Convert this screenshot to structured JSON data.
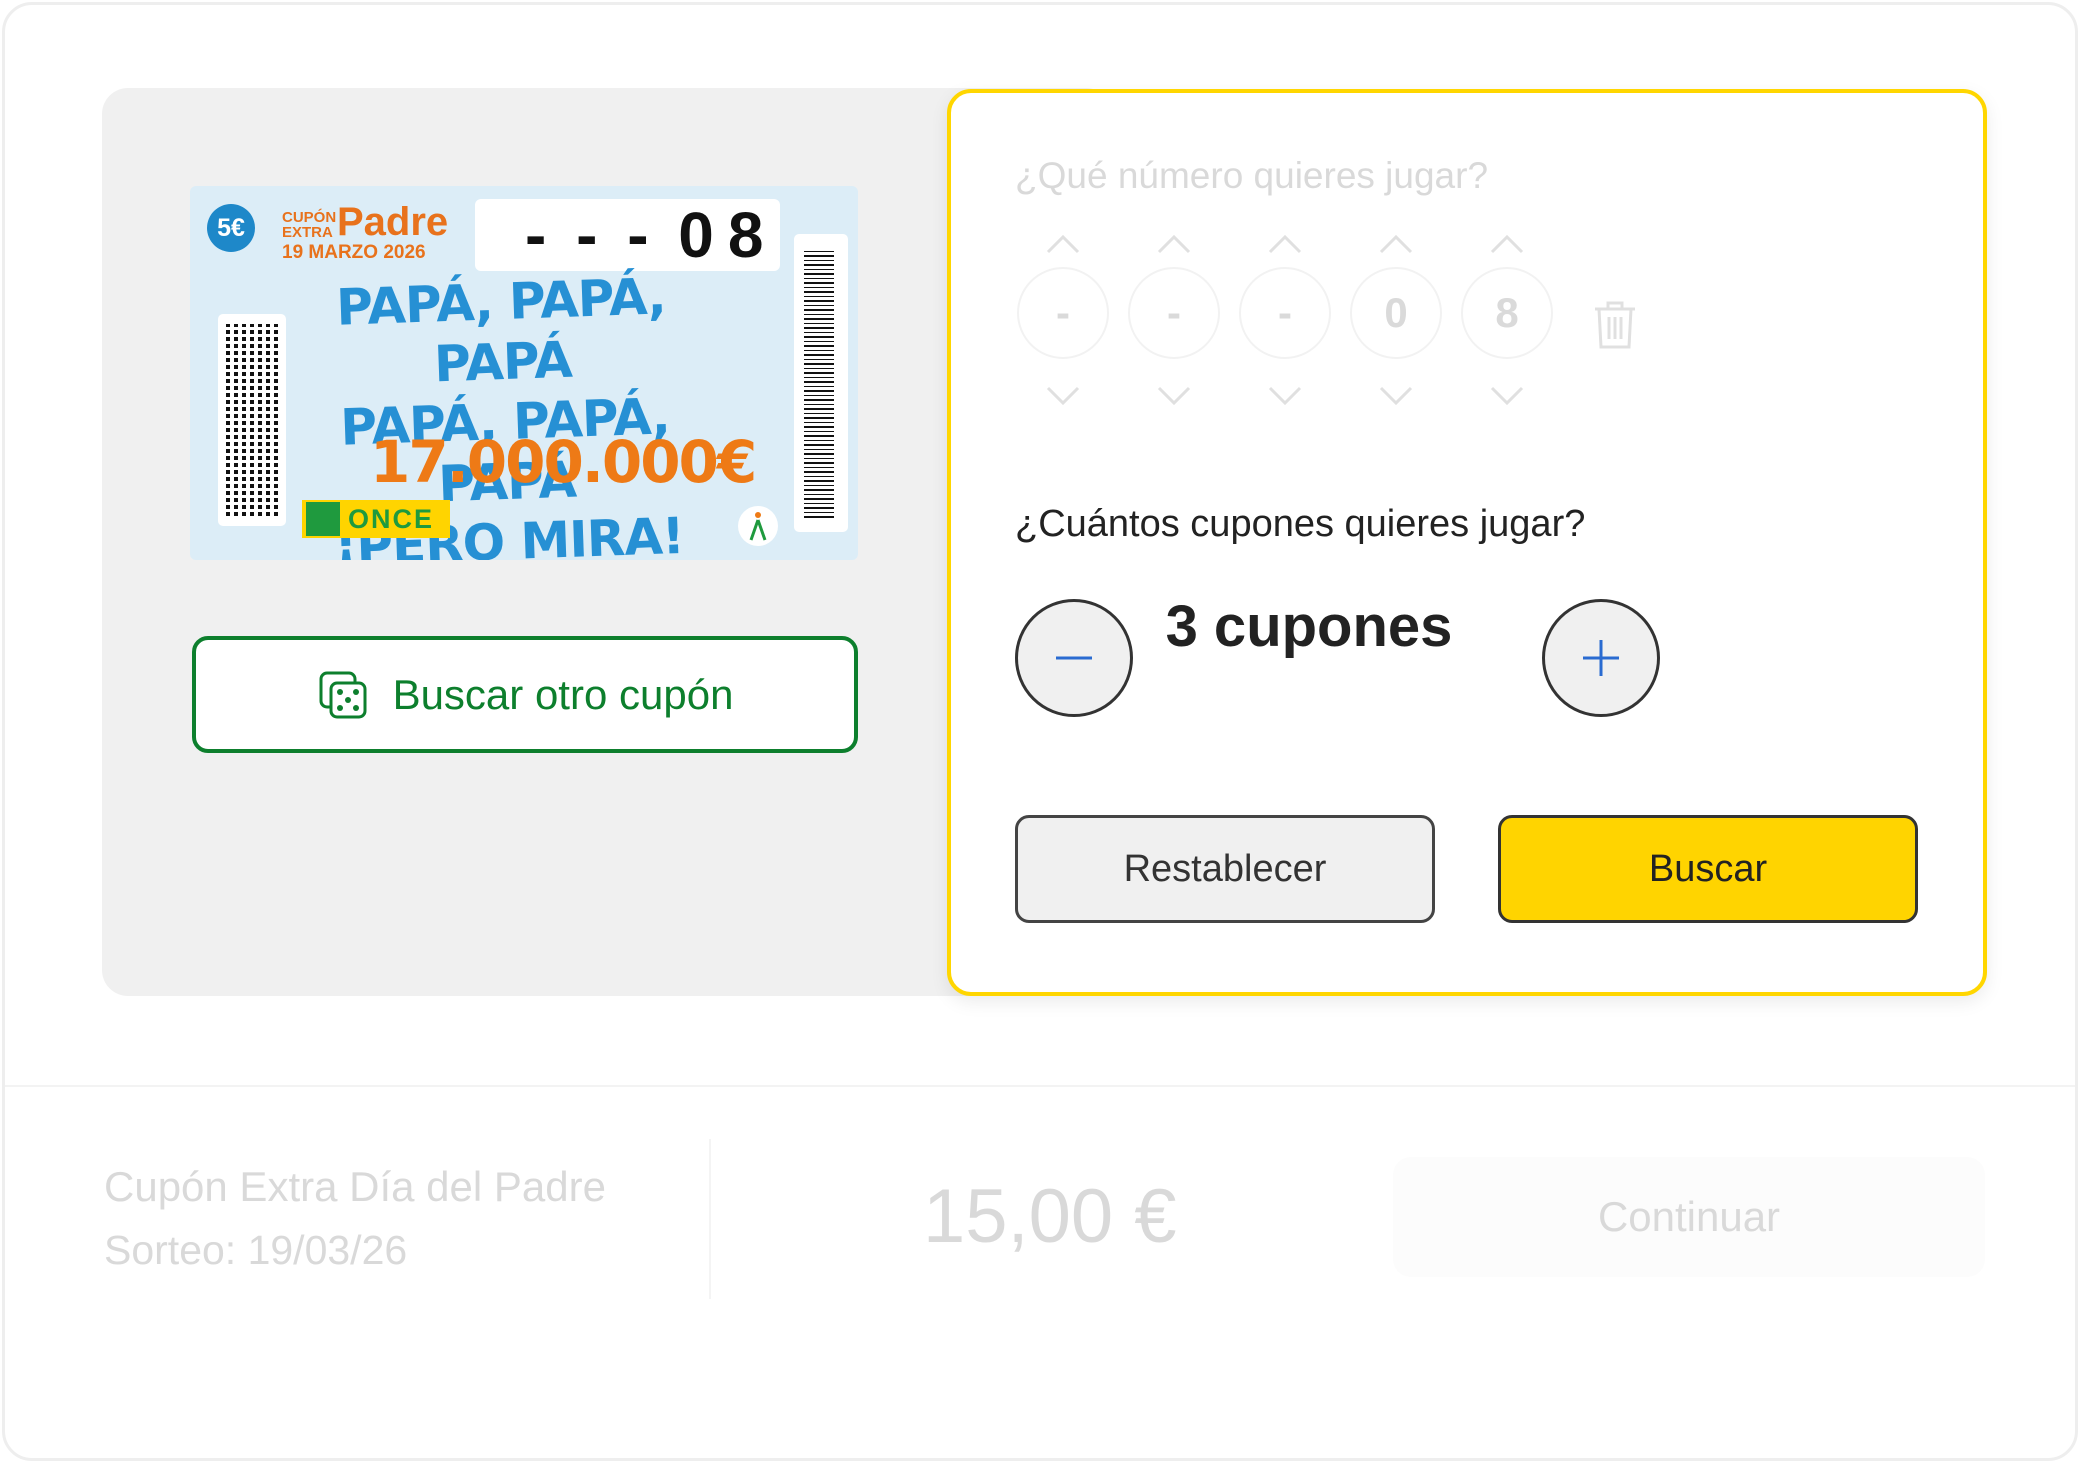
{
  "ticket": {
    "price_badge": "5€",
    "cupon_label": "CUPÓN EXTRA",
    "brand_word": "Padre",
    "draw_date": "19 MARZO 2026",
    "number_dashes": "- - -",
    "number_digits": "08",
    "slogan_line1": "PAPÁ, PAPÁ, PAPÁ",
    "slogan_line2": "PAPÁ, PAPÁ, PAPÁ",
    "slogan_line3": "¡PERO MIRA!",
    "prize": "17.000.000€",
    "once_logo_text": "ONCE"
  },
  "search_other_button": {
    "label": "Buscar otro cupón",
    "icon": "dice-icon"
  },
  "number_picker": {
    "question": "¿Qué número quieres jugar?",
    "digits": [
      "-",
      "-",
      "-",
      "0",
      "8"
    ],
    "clear_icon": "trash-icon"
  },
  "coupons": {
    "question": "¿Cuántos cupones quieres jugar?",
    "count_label": "3 cupones",
    "minus_icon": "minus-icon",
    "plus_icon": "plus-icon"
  },
  "actions": {
    "reset_label": "Restablecer",
    "search_label": "Buscar"
  },
  "summary": {
    "product_name": "Cupón Extra Día del Padre",
    "draw": "Sorteo: 19/03/26",
    "price": "15,00 €",
    "continue_label": "Continuar"
  },
  "colors": {
    "accent_yellow": "#ffd400",
    "once_green": "#0d7f2d",
    "disabled_text": "#d9d9d9"
  }
}
